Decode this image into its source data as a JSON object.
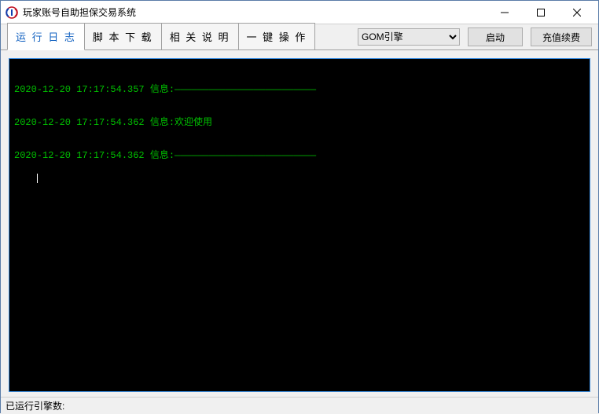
{
  "window": {
    "title": "玩家账号自助担保交易系统"
  },
  "tabs": {
    "items": [
      {
        "label": "运 行 日 志",
        "active": true
      },
      {
        "label": "脚 本 下 载",
        "active": false
      },
      {
        "label": "相 关 说 明",
        "active": false
      },
      {
        "label": "一 键 操 作",
        "active": false
      }
    ]
  },
  "engine": {
    "selected": "GOM引擎",
    "options": [
      "GOM引擎"
    ]
  },
  "buttons": {
    "start": "启动",
    "recharge": "充值续费"
  },
  "log": {
    "lines": [
      "2020-12-20 17:17:54.357 信息:—————————————————————————",
      "2020-12-20 17:17:54.362 信息:欢迎使用",
      "2020-12-20 17:17:54.362 信息:—————————————————————————"
    ]
  },
  "status": {
    "label": "已运行引擎数:",
    "value": ""
  }
}
